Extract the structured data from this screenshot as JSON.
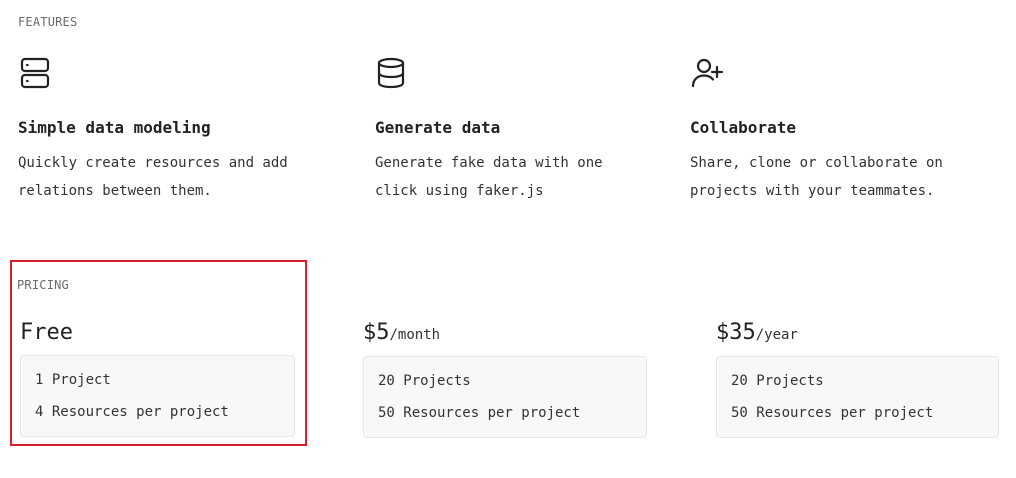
{
  "features": {
    "label": "FEATURES",
    "items": [
      {
        "icon": "server-icon",
        "title": "Simple data modeling",
        "description": "Quickly create resources and add relations between them."
      },
      {
        "icon": "database-icon",
        "title": "Generate data",
        "description": "Generate fake data with one click using faker.js"
      },
      {
        "icon": "user-plus-icon",
        "title": "Collaborate",
        "description": "Share, clone or collaborate on projects with your teammates."
      }
    ]
  },
  "pricing": {
    "label": "PRICING",
    "highlight_color": "#d9202a",
    "plans": [
      {
        "price": "Free",
        "period": "",
        "items": [
          "1 Project",
          "4 Resources per project"
        ]
      },
      {
        "price": "$5",
        "period": "/month",
        "items": [
          "20 Projects",
          "50 Resources per project"
        ]
      },
      {
        "price": "$35",
        "period": "/year",
        "items": [
          "20 Projects",
          "50 Resources per project"
        ]
      }
    ]
  }
}
